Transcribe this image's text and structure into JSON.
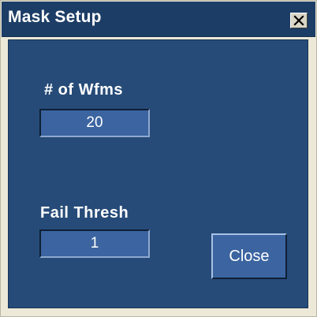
{
  "window": {
    "title": "Mask Setup",
    "close_icon": "close-x-icon"
  },
  "fields": {
    "num_wfms": {
      "label": "# of Wfms",
      "value": "20"
    },
    "fail_thresh": {
      "label": "Fail Thresh",
      "value": "1"
    }
  },
  "buttons": {
    "close_label": "Close"
  },
  "colors": {
    "titlebar": "#1c3d66",
    "panel": "#264b78",
    "field": "#3b64a0",
    "text": "#ffffff"
  }
}
